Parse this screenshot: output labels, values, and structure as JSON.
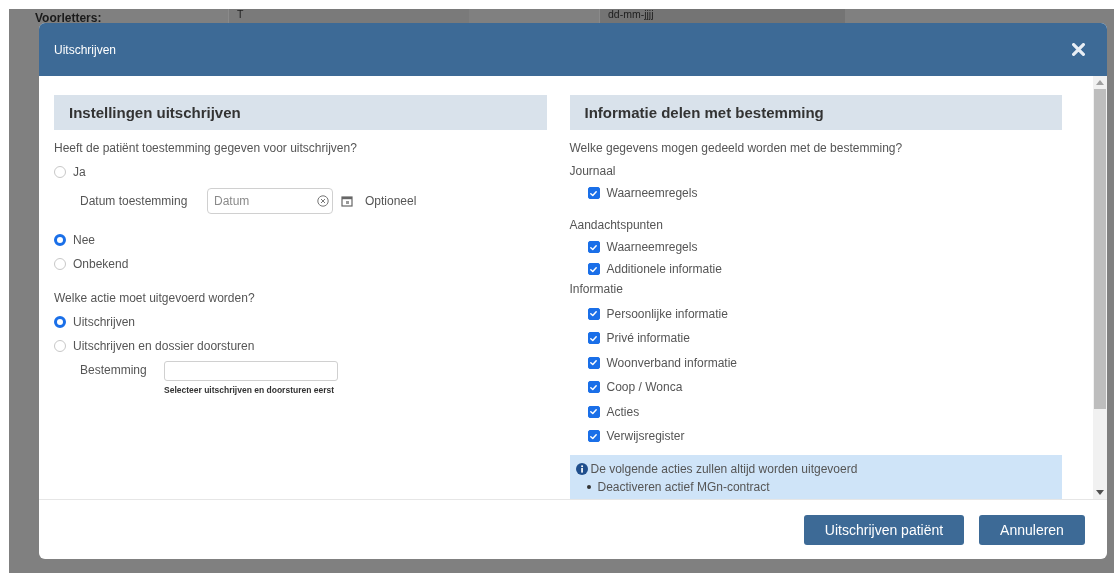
{
  "background": {
    "fields": [
      {
        "label": "Voorletters:",
        "value": "T"
      },
      {
        "value": "dd-mm-jjjj"
      }
    ]
  },
  "dialog": {
    "title": "Uitschrijven",
    "left": {
      "heading": "Instellingen uitschrijven",
      "consent": {
        "question": "Heeft de patiënt toestemming gegeven voor uitschrijven?",
        "options": [
          {
            "label": "Ja",
            "selected": false,
            "date_field": {
              "label": "Datum toestemming",
              "placeholder": "Datum",
              "note": "Optioneel"
            }
          },
          {
            "label": "Nee",
            "selected": true
          },
          {
            "label": "Onbekend",
            "selected": false
          }
        ]
      },
      "action": {
        "question": "Welke actie moet uitgevoerd worden?",
        "options": [
          {
            "label": "Uitschrijven",
            "selected": true
          },
          {
            "label": "Uitschrijven en dossier doorsturen",
            "selected": false,
            "destination_field": {
              "label": "Bestemming",
              "hint": "Selecteer uitschrijven en doorsturen eerst"
            }
          }
        ]
      }
    },
    "right": {
      "heading": "Informatie delen met bestemming",
      "question": "Welke gegevens mogen gedeeld worden met de bestemming?",
      "groups": [
        {
          "title": "Journaal",
          "items": [
            {
              "label": "Waarneemregels",
              "checked": true
            }
          ]
        },
        {
          "title": "Aandachtspunten",
          "items": [
            {
              "label": "Waarneemregels",
              "checked": true
            },
            {
              "label": "Additionele informatie",
              "checked": true
            }
          ]
        },
        {
          "title": "Informatie",
          "items": [
            {
              "label": "Persoonlijke informatie",
              "checked": true
            },
            {
              "label": "Privé informatie",
              "checked": true
            },
            {
              "label": "Woonverband informatie",
              "checked": true
            },
            {
              "label": "Coop / Wonca",
              "checked": true
            },
            {
              "label": "Acties",
              "checked": true
            },
            {
              "label": "Verwijsregister",
              "checked": true
            }
          ]
        }
      ],
      "info": {
        "title": "De volgende acties zullen altijd worden uitgevoerd",
        "items": [
          "Deactiveren actief MGn-contract"
        ]
      }
    },
    "buttons": [
      "Uitschrijven patiënt",
      "Annuleren"
    ]
  }
}
